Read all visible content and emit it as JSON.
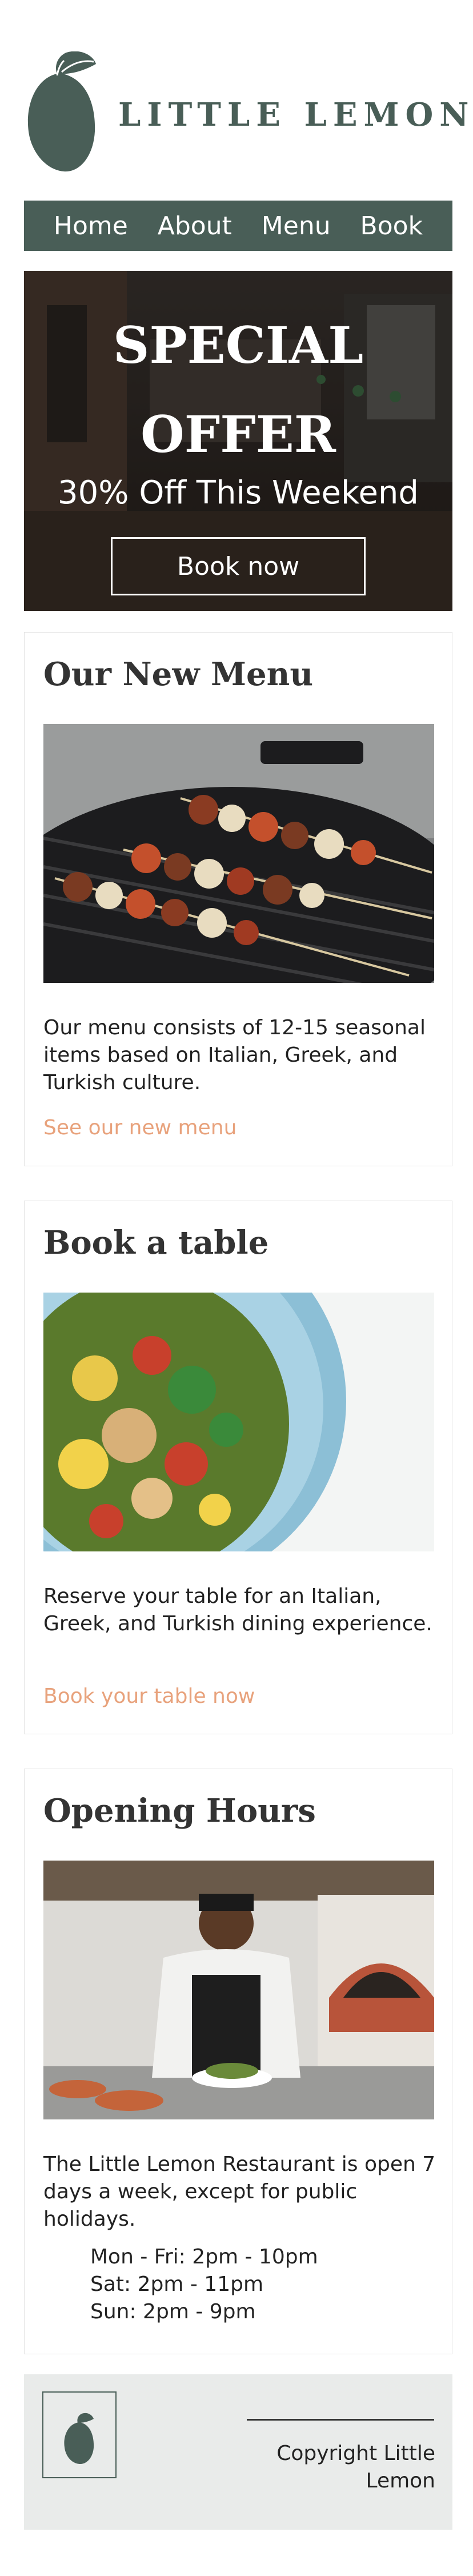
{
  "brand": {
    "name": "LITTLE LEMON",
    "accent": "#495e57",
    "link_color": "#e8a27c"
  },
  "nav": {
    "items": [
      "Home",
      "About",
      "Menu",
      "Book"
    ]
  },
  "hero": {
    "title_line1": "SPECIAL",
    "title_line2": "OFFER",
    "subtitle": "30% Off This Weekend",
    "button_label": "Book now"
  },
  "menu_card": {
    "title": "Our New Menu",
    "text": "Our menu consists of 12-15 seasonal items based on Italian, Greek, and Turkish culture.",
    "link": "See our new menu"
  },
  "book_card": {
    "title": "Book a table",
    "text": "Reserve your table for an Italian, Greek, and Turkish dining experience.",
    "link": "Book your table now"
  },
  "hours_card": {
    "title": "Opening Hours",
    "text": "The Little Lemon Restaurant is open 7 days a week, except for public holidays.",
    "hours": [
      "Mon - Fri: 2pm - 10pm",
      "Sat: 2pm - 11pm",
      "Sun: 2pm - 9pm"
    ]
  },
  "footer": {
    "copyright": "Copyright Little Lemon"
  }
}
